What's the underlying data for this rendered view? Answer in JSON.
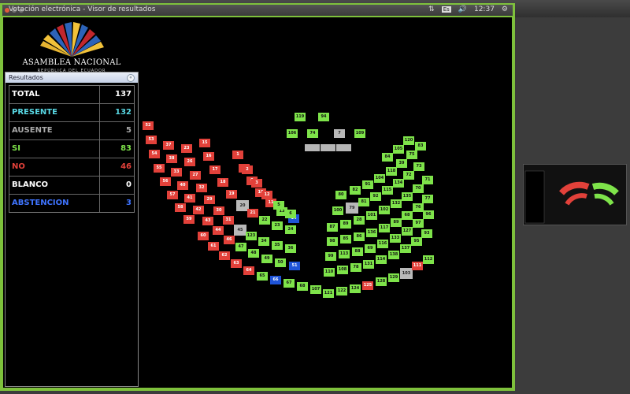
{
  "window": {
    "title": "Votación electrónica - Visor de resultados",
    "close_label": "Cerrar",
    "minimize_label": "Minimizar",
    "maximize_label": "Maximizar"
  },
  "tray": {
    "keyboard": "Es",
    "time": "12:37"
  },
  "logo": {
    "title": "ASAMBLEA NACIONAL",
    "subtitle": "REPÚBLICA DEL ECUADOR"
  },
  "panel": {
    "title": "Resultados",
    "rows": [
      {
        "label": "TOTAL",
        "value": "137",
        "color": "#ffffff"
      },
      {
        "label": "PRESENTE",
        "value": "132",
        "color": "#58d7e3"
      },
      {
        "label": "AUSENTE",
        "value": "5",
        "color": "#aaaaaa"
      },
      {
        "label": "SI",
        "value": "83",
        "color": "#7ee34a"
      },
      {
        "label": "NO",
        "value": "46",
        "color": "#e2413a"
      },
      {
        "label": "BLANCO",
        "value": "0",
        "color": "#ffffff"
      },
      {
        "label": "ABSTENCION",
        "value": "3",
        "color": "#3f74ff"
      }
    ]
  },
  "colors": {
    "si": "#7ee34a",
    "no": "#e2413a",
    "abstencion": "#1f54d8",
    "ausente": "#b9b9b9"
  },
  "seats": [
    {
      "n": "119",
      "s": "si"
    },
    {
      "n": "94",
      "s": "si"
    },
    {
      "n": "106",
      "s": "si"
    },
    {
      "n": "74",
      "s": "si"
    },
    {
      "n": "7",
      "s": "ausente"
    },
    {
      "n": "109",
      "s": "si"
    },
    {
      "n": "52",
      "s": "no"
    },
    {
      "n": "53",
      "s": "no"
    },
    {
      "n": "54",
      "s": "no"
    },
    {
      "n": "55",
      "s": "no"
    },
    {
      "n": "56",
      "s": "no"
    },
    {
      "n": "57",
      "s": "no"
    },
    {
      "n": "58",
      "s": "no"
    },
    {
      "n": "59",
      "s": "no"
    },
    {
      "n": "60",
      "s": "no"
    },
    {
      "n": "61",
      "s": "no"
    },
    {
      "n": "62",
      "s": "no"
    },
    {
      "n": "63",
      "s": "no"
    },
    {
      "n": "64",
      "s": "no"
    },
    {
      "n": "65",
      "s": "si"
    },
    {
      "n": "66",
      "s": "abstencion"
    },
    {
      "n": "67",
      "s": "si"
    },
    {
      "n": "68",
      "s": "si"
    },
    {
      "n": "107",
      "s": "si"
    },
    {
      "n": "37",
      "s": "no"
    },
    {
      "n": "38",
      "s": "no"
    },
    {
      "n": "33",
      "s": "no"
    },
    {
      "n": "40",
      "s": "no"
    },
    {
      "n": "41",
      "s": "no"
    },
    {
      "n": "42",
      "s": "no"
    },
    {
      "n": "43",
      "s": "no"
    },
    {
      "n": "44",
      "s": "no"
    },
    {
      "n": "46",
      "s": "no"
    },
    {
      "n": "47",
      "s": "si"
    },
    {
      "n": "48",
      "s": "si"
    },
    {
      "n": "49",
      "s": "si"
    },
    {
      "n": "50",
      "s": "si"
    },
    {
      "n": "51",
      "s": "abstencion"
    },
    {
      "n": "23",
      "s": "no"
    },
    {
      "n": "26",
      "s": "no"
    },
    {
      "n": "27",
      "s": "no"
    },
    {
      "n": "32",
      "s": "no"
    },
    {
      "n": "29",
      "s": "no"
    },
    {
      "n": "30",
      "s": "no"
    },
    {
      "n": "31",
      "s": "no"
    },
    {
      "n": "45",
      "s": "ausente"
    },
    {
      "n": "123",
      "s": "si"
    },
    {
      "n": "34",
      "s": "si"
    },
    {
      "n": "35",
      "s": "si"
    },
    {
      "n": "36",
      "s": "si"
    },
    {
      "n": "15",
      "s": "no"
    },
    {
      "n": "16",
      "s": "no"
    },
    {
      "n": "17",
      "s": "no"
    },
    {
      "n": "18",
      "s": "no"
    },
    {
      "n": "19",
      "s": "no"
    },
    {
      "n": "20",
      "s": "ausente"
    },
    {
      "n": "21",
      "s": "no"
    },
    {
      "n": "22",
      "s": "si"
    },
    {
      "n": "23",
      "s": "si"
    },
    {
      "n": "24",
      "s": "si"
    },
    {
      "n": "1",
      "s": "no"
    },
    {
      "n": "8",
      "s": "no"
    },
    {
      "n": "9",
      "s": "no"
    },
    {
      "n": "10",
      "s": "no"
    },
    {
      "n": "11",
      "s": "no"
    },
    {
      "n": "13",
      "s": "si"
    },
    {
      "n": "14",
      "s": "abstencion"
    },
    {
      "n": "2",
      "s": "no"
    },
    {
      "n": "3",
      "s": "no"
    },
    {
      "n": "12",
      "s": "no"
    },
    {
      "n": "5",
      "s": "si"
    },
    {
      "n": "6",
      "s": "si"
    },
    {
      "n": "121",
      "s": "si"
    },
    {
      "n": "122",
      "s": "si"
    },
    {
      "n": "124",
      "s": "si"
    },
    {
      "n": "125",
      "s": "no"
    },
    {
      "n": "128",
      "s": "si"
    },
    {
      "n": "129",
      "s": "si"
    },
    {
      "n": "103",
      "s": "ausente"
    },
    {
      "n": "111",
      "s": "no"
    },
    {
      "n": "112",
      "s": "si"
    },
    {
      "n": "110",
      "s": "si"
    },
    {
      "n": "108",
      "s": "si"
    },
    {
      "n": "78",
      "s": "si"
    },
    {
      "n": "131",
      "s": "si"
    },
    {
      "n": "114",
      "s": "si"
    },
    {
      "n": "138",
      "s": "si"
    },
    {
      "n": "137",
      "s": "si"
    },
    {
      "n": "95",
      "s": "si"
    },
    {
      "n": "93",
      "s": "si"
    },
    {
      "n": "99",
      "s": "si"
    },
    {
      "n": "113",
      "s": "si"
    },
    {
      "n": "88",
      "s": "si"
    },
    {
      "n": "69",
      "s": "si"
    },
    {
      "n": "116",
      "s": "si"
    },
    {
      "n": "133",
      "s": "si"
    },
    {
      "n": "127",
      "s": "si"
    },
    {
      "n": "97",
      "s": "si"
    },
    {
      "n": "96",
      "s": "si"
    },
    {
      "n": "98",
      "s": "si"
    },
    {
      "n": "85",
      "s": "si"
    },
    {
      "n": "86",
      "s": "si"
    },
    {
      "n": "136",
      "s": "si"
    },
    {
      "n": "117",
      "s": "si"
    },
    {
      "n": "89",
      "s": "si"
    },
    {
      "n": "68",
      "s": "si"
    },
    {
      "n": "76",
      "s": "si"
    },
    {
      "n": "77",
      "s": "si"
    },
    {
      "n": "87",
      "s": "si"
    },
    {
      "n": "89",
      "s": "si"
    },
    {
      "n": "28",
      "s": "si"
    },
    {
      "n": "101",
      "s": "si"
    },
    {
      "n": "102",
      "s": "si"
    },
    {
      "n": "132",
      "s": "si"
    },
    {
      "n": "135",
      "s": "si"
    },
    {
      "n": "70",
      "s": "si"
    },
    {
      "n": "71",
      "s": "si"
    },
    {
      "n": "100",
      "s": "si"
    },
    {
      "n": "79",
      "s": "ausente"
    },
    {
      "n": "81",
      "s": "si"
    },
    {
      "n": "92",
      "s": "si"
    },
    {
      "n": "115",
      "s": "si"
    },
    {
      "n": "134",
      "s": "si"
    },
    {
      "n": "72",
      "s": "si"
    },
    {
      "n": "73",
      "s": "si"
    },
    {
      "n": "80",
      "s": "si"
    },
    {
      "n": "82",
      "s": "si"
    },
    {
      "n": "91",
      "s": "si"
    },
    {
      "n": "104",
      "s": "si"
    },
    {
      "n": "118",
      "s": "si"
    },
    {
      "n": "39",
      "s": "si"
    },
    {
      "n": "75",
      "s": "si"
    },
    {
      "n": "83",
      "s": "si"
    },
    {
      "n": "84",
      "s": "si"
    },
    {
      "n": "105",
      "s": "si"
    },
    {
      "n": "120",
      "s": "si"
    }
  ]
}
